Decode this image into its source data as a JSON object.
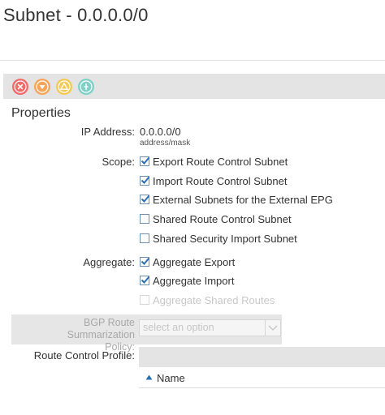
{
  "header": {
    "title": "Subnet - 0.0.0.0/0"
  },
  "toolbar": {
    "buttons": [
      {
        "icon": "delete-icon",
        "color": "#f26b6b"
      },
      {
        "icon": "down-arrow-icon",
        "color": "#f5a55a"
      },
      {
        "icon": "warning-icon",
        "color": "#f5c957"
      },
      {
        "icon": "info-icon",
        "color": "#7fd1c8"
      }
    ]
  },
  "properties": {
    "section_title": "Properties",
    "ip_address": {
      "label": "IP Address:",
      "value": "0.0.0.0/0",
      "hint": "address/mask"
    },
    "scope": {
      "label": "Scope:",
      "options": [
        {
          "label": "Export Route Control Subnet",
          "checked": true
        },
        {
          "label": "Import Route Control Subnet",
          "checked": true
        },
        {
          "label": "External Subnets for the External EPG",
          "checked": true
        },
        {
          "label": "Shared Route Control Subnet",
          "checked": false
        },
        {
          "label": "Shared Security Import Subnet",
          "checked": false
        }
      ]
    },
    "aggregate": {
      "label": "Aggregate:",
      "options": [
        {
          "label": "Aggregate Export",
          "checked": true
        },
        {
          "label": "Aggregate Import",
          "checked": true
        },
        {
          "label": "Aggregate Shared Routes",
          "checked": false,
          "disabled": true
        }
      ]
    },
    "bgp_policy": {
      "label_line1": "BGP Route Summarization",
      "label_line2": "Policy:",
      "placeholder": "select an option"
    },
    "route_control_profile": {
      "label": "Route Control Profile:",
      "column_name": "Name"
    }
  },
  "colors": {
    "checkmark": "#2a6fb5",
    "toolbar_bg": "#e4e4e4"
  }
}
